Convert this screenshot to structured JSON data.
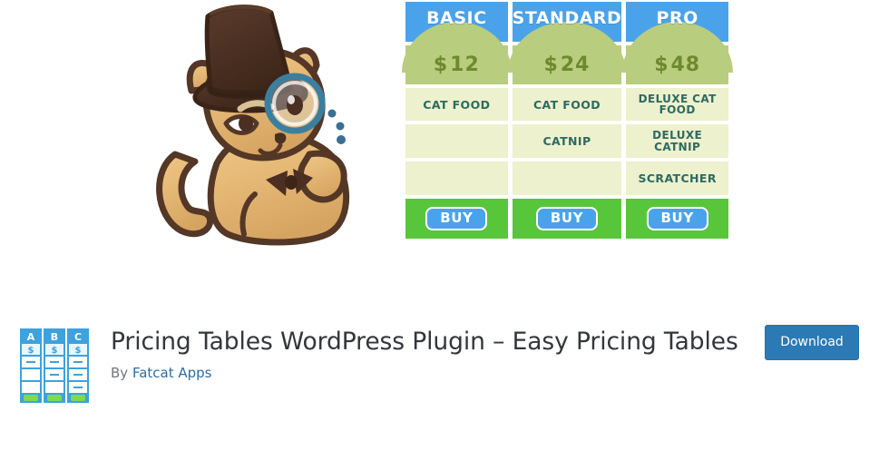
{
  "banner": {
    "illustration": {
      "name": "fancy-cat-with-top-hat-and-monocle",
      "alt": "Cat wearing a top hat, monocle and bow tie"
    },
    "pricing_table_graphic": {
      "columns": [
        {
          "plan": "BASIC",
          "currency": "$",
          "price": "12",
          "features": [
            "CAT FOOD",
            "",
            ""
          ],
          "cta": "BUY"
        },
        {
          "plan": "STANDARD",
          "currency": "$",
          "price": "24",
          "features": [
            "CAT FOOD",
            "CATNIP",
            ""
          ],
          "cta": "BUY"
        },
        {
          "plan": "PRO",
          "currency": "$",
          "price": "48",
          "features": [
            "DELUXE CAT FOOD",
            "DELUXE CATNIP",
            "SCRATCHER"
          ],
          "cta": "BUY"
        }
      ],
      "colors": {
        "header_blue": "#4aa3ea",
        "price_green": "#b9cd7e",
        "price_text": "#6d8a2e",
        "feature_bg": "#edf1cd",
        "feature_text": "#2d6a62",
        "footer_green": "#58c63a"
      }
    }
  },
  "plugin": {
    "icon_name": "pricing-table-icon",
    "icon_labels": [
      "A",
      "B",
      "C"
    ],
    "icon_currency": "$",
    "title": "Pricing Tables WordPress Plugin – Easy Pricing Tables",
    "by_label": "By",
    "author": "Fatcat Apps",
    "download_label": "Download",
    "colors": {
      "title": "#32373c",
      "byline": "#72777c",
      "link": "#2e6ca3",
      "button": "#2b7ab5"
    }
  }
}
